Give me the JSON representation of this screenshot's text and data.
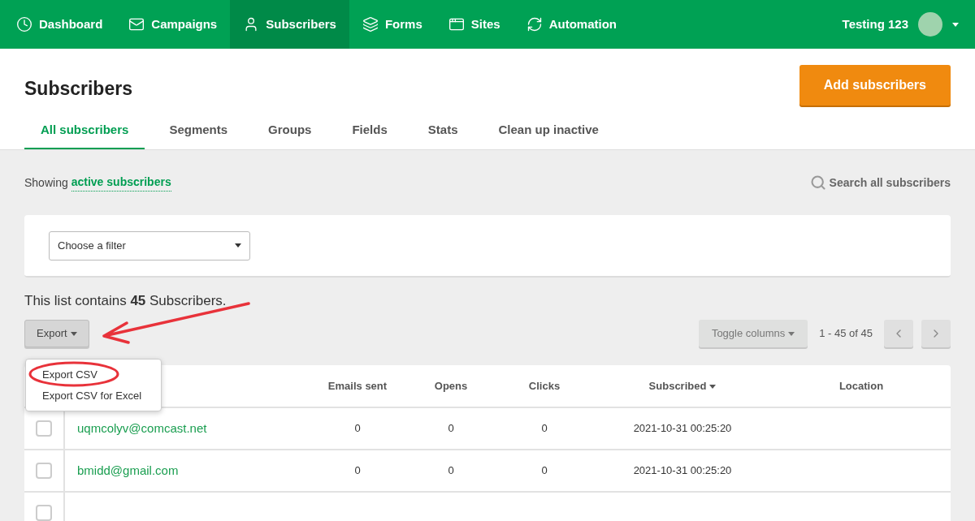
{
  "nav": {
    "items": [
      {
        "label": "Dashboard",
        "selected": false
      },
      {
        "label": "Campaigns",
        "selected": false
      },
      {
        "label": "Subscribers",
        "selected": true
      },
      {
        "label": "Forms",
        "selected": false
      },
      {
        "label": "Sites",
        "selected": false
      },
      {
        "label": "Automation",
        "selected": false
      }
    ],
    "account": "Testing 123"
  },
  "page": {
    "title": "Subscribers",
    "primary_button": "Add subscribers",
    "tabs": [
      {
        "label": "All subscribers",
        "selected": true
      },
      {
        "label": "Segments",
        "selected": false
      },
      {
        "label": "Groups",
        "selected": false
      },
      {
        "label": "Fields",
        "selected": false
      },
      {
        "label": "Stats",
        "selected": false
      },
      {
        "label": "Clean up inactive",
        "selected": false
      }
    ]
  },
  "showing": {
    "prefix": "Showing",
    "link": "active subscribers",
    "search": "Search all subscribers"
  },
  "filter": {
    "value": "Choose a filter"
  },
  "summary": "This list contains **45** Subscribers.",
  "export": {
    "label": "Export",
    "expanded": true,
    "menu": [
      "Export CSV",
      "Export CSV for Excel"
    ]
  },
  "toggle_columns": "Toggle columns",
  "pagination": "1 - 45 of 45",
  "table": {
    "columns": [
      "Emails sent",
      "Opens",
      "Clicks",
      "Subscribed",
      "Location"
    ],
    "rows": [
      {
        "checked": false,
        "email": "uqmcolyv@comcast.net",
        "cells": [
          "0",
          "0",
          "0",
          "2021-10-31 00:25:20",
          ""
        ]
      },
      {
        "checked": false,
        "email": "bmidd@gmail.com",
        "cells": [
          "0",
          "0",
          "0",
          "2021-10-31 00:25:20",
          ""
        ]
      },
      {
        "checked": false
      }
    ]
  }
}
